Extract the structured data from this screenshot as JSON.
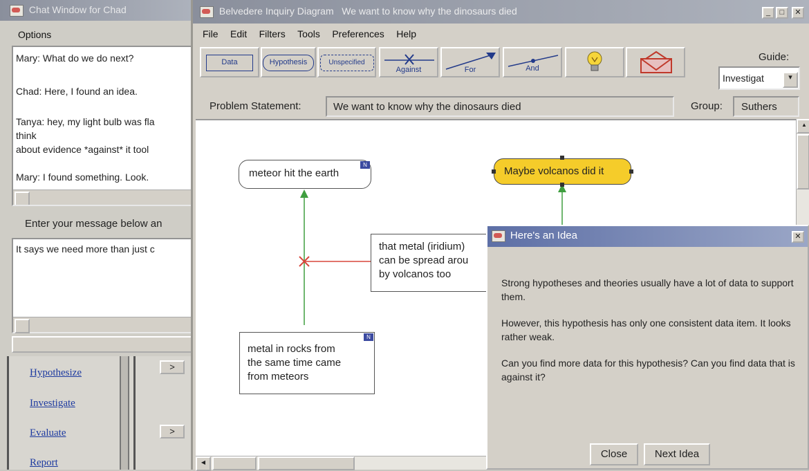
{
  "chat": {
    "title": "Chat Window for Chad",
    "menu": "Options",
    "messages": [
      "Mary: What do we do next?",
      "Chad: Here, I found an idea.",
      "Tanya: hey, my light bulb was fla",
      "think",
      "about evidence *against* it tool",
      "Mary: I found something. Look."
    ],
    "prompt": "Enter your message below an",
    "input_value": "It says we need more than just c",
    "nav_links": [
      "Hypothesize",
      "Investigate",
      "Evaluate",
      "Report"
    ],
    "expand_label": ">"
  },
  "main": {
    "title": "Belvedere Inquiry Diagram   We want to know why the dinosaurs died",
    "menu": [
      "File",
      "Edit",
      "Filters",
      "Tools",
      "Preferences",
      "Help"
    ],
    "toolbar": {
      "data": "Data",
      "hypothesis": "Hypothesis",
      "unspecified": "Unspecified",
      "against": "Against",
      "for": "For",
      "and": "And"
    },
    "guide_label": "Guide:",
    "guide_value": "Investigat",
    "problem_label": "Problem Statement:",
    "problem_value": "We want to know why the dinosaurs died",
    "group_label": "Group:",
    "group_value": "Suthers",
    "nodes": {
      "meteor": "meteor hit the earth",
      "volcano": "Maybe volcanos did it",
      "iridium_1": "that metal (iridium)",
      "iridium_2": "can be spread arou",
      "iridium_3": "by volcanos too",
      "rocks_1": "metal in rocks from",
      "rocks_2": "the same time came",
      "rocks_3": "from meteors"
    },
    "node_badge": "N",
    "window_buttons": {
      "minimize": "_",
      "maximize": "□",
      "close": "✕"
    }
  },
  "idea": {
    "title": "Here's an Idea",
    "close_icon": "✕",
    "paragraphs": [
      "Strong hypotheses and theories usually have a lot of data to support them.",
      "However, this hypothesis has only one consistent data item. It looks rather weak.",
      "Can you find more data for this hypothesis? Can you find data that is against it?"
    ],
    "close_button": "Close",
    "next_button": "Next Idea"
  },
  "colors": {
    "hypothesis_fill": "#f5cc2a",
    "for_link": "#3f9e3f",
    "against_link": "#d8463a",
    "nav_link": "#1d3aa0"
  }
}
